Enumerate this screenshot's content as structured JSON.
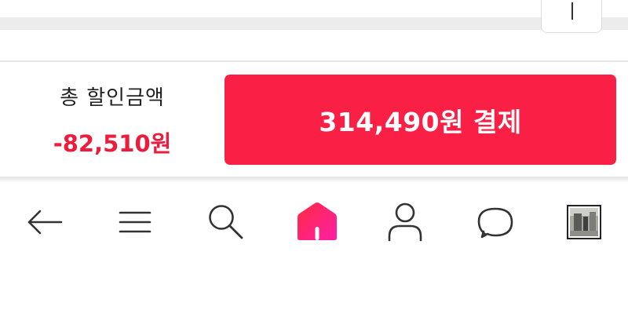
{
  "summary": {
    "discount_label": "총 할인금액",
    "discount_amount": "-82,510원"
  },
  "pay_button": {
    "label": "314,490원 결제"
  },
  "bottom_nav": {
    "items": [
      {
        "name": "back",
        "icon": "arrow-left-icon"
      },
      {
        "name": "menu",
        "icon": "hamburger-menu-icon"
      },
      {
        "name": "search",
        "icon": "search-icon"
      },
      {
        "name": "home",
        "icon": "home-icon"
      },
      {
        "name": "my-page",
        "icon": "user-icon"
      },
      {
        "name": "chat",
        "icon": "chat-bubble-icon"
      },
      {
        "name": "recent-view",
        "icon": "recent-product-thumbnail"
      }
    ]
  },
  "colors": {
    "accent": "#fa1f45",
    "discount_text": "#ec1c3c",
    "home_gradient_start": "#ff2a3f",
    "home_gradient_end": "#ff1fa8"
  }
}
